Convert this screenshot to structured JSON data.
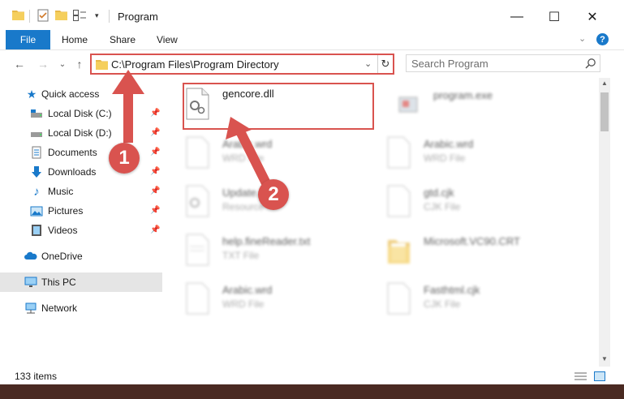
{
  "window": {
    "title": "Program",
    "controls": {
      "minimize": "—",
      "maximize": "☐",
      "close": "✕"
    }
  },
  "ribbon": {
    "tabs": [
      "File",
      "Home",
      "Share",
      "View"
    ],
    "accent": "#1979ca"
  },
  "nav": {
    "address": "C:\\Program Files\\Program Directory",
    "search_placeholder": "Search Program"
  },
  "sidebar": {
    "items": [
      {
        "label": "Quick access",
        "icon": "star-icon"
      },
      {
        "label": "Local Disk (C:)",
        "icon": "drive-c-icon"
      },
      {
        "label": "Local Disk (D:)",
        "icon": "drive-d-icon"
      },
      {
        "label": "Documents",
        "icon": "documents-icon"
      },
      {
        "label": "Downloads",
        "icon": "downloads-icon"
      },
      {
        "label": "Music",
        "icon": "music-icon"
      },
      {
        "label": "Pictures",
        "icon": "pictures-icon"
      },
      {
        "label": "Videos",
        "icon": "videos-icon"
      },
      {
        "label": "OneDrive",
        "icon": "onedrive-icon"
      },
      {
        "label": "This PC",
        "icon": "this-pc-icon"
      },
      {
        "label": "Network",
        "icon": "network-icon"
      }
    ]
  },
  "files": [
    {
      "name": "gencore.dll",
      "type": ""
    },
    {
      "name": "program.exe",
      "type": ""
    },
    {
      "name": "Arabic.wrd",
      "type": "WRD File"
    },
    {
      "name": "Arabic.wrd",
      "type": "WRD File"
    },
    {
      "name": "Update.dll",
      "type": "Resource"
    },
    {
      "name": "gtd.cjk",
      "type": "CJK File"
    },
    {
      "name": "help.fineReader.txt",
      "type": "TXT File"
    },
    {
      "name": "Microsoft.VC90.CRT",
      "type": ""
    },
    {
      "name": "Arabic.wrd",
      "type": "WRD File"
    },
    {
      "name": "Fasthtml.cjk",
      "type": "CJK File"
    }
  ],
  "status": {
    "count": "133 items"
  },
  "callouts": {
    "one": "1",
    "two": "2"
  },
  "highlight_color": "#d9534f"
}
